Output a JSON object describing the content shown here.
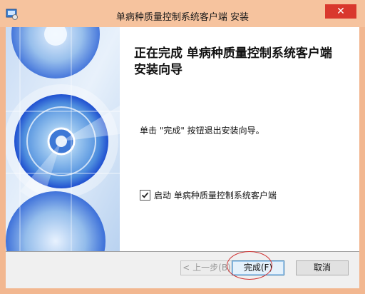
{
  "window": {
    "title": "单病种质量控制系统客户端 安装",
    "close_glyph": "✕"
  },
  "content": {
    "heading": "正在完成 单病种质量控制系统客户端 安装向导",
    "description": "单击 \"完成\" 按钮退出安装向导。",
    "run_checkbox": {
      "label": "启动 单病种质量控制系统客户端",
      "checked": true
    }
  },
  "buttons": {
    "back": "< 上一步(B)",
    "finish": "完成(F)",
    "cancel": "取消"
  },
  "colors": {
    "titlebar": "#f6c39e",
    "close": "#d9382d",
    "banner_blue": "#1f4fd0",
    "annotation": "#d13232"
  }
}
